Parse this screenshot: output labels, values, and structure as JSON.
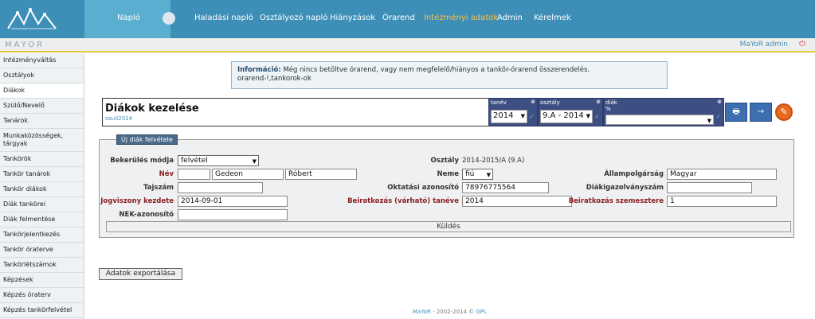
{
  "nav": {
    "active": "Napló",
    "items": [
      "Haladási napló",
      "Osztályozó napló",
      "Hiányzások",
      "Órarend",
      "Intézményi adatok",
      "Admin",
      "Kérelmek"
    ]
  },
  "brand": "MAYOR",
  "user": "MaYoR admin",
  "sidebar": [
    "Intézményváltás",
    "Osztályok",
    "Diákok",
    "Szülő/Nevelő",
    "Tanárok",
    "Munkaközösségek, tárgyak",
    "Tankörök",
    "Tankör tanárok",
    "Tankör diákok",
    "Diák tankörei",
    "Diák felmentése",
    "Tankörjelentkezés",
    "Tankör óraterve",
    "Tankörlétszámok",
    "Képzések",
    "Képzés óraterv",
    "Képzés tankörfelvétel"
  ],
  "info": {
    "label": "Információ:",
    "text": "Még nincs betöltve órarend, vagy nem megfelelő/hiányos a tankör-órarend összerendelés.",
    "line2": "orarend-!,tankorok-ok"
  },
  "header": {
    "title": "Diákok kezelése",
    "subtitle": "osuli2014",
    "tanev_label": "tanév",
    "tanev_value": "2014",
    "osztaly_label": "osztály",
    "osztaly_value": "9.A - 2014",
    "diak_label": "diák",
    "diak_sub": "%",
    "print_icon": "print-icon",
    "next_icon": "arrow-right-icon"
  },
  "form": {
    "legend": "Új diák felvétele",
    "bekerules_label": "Bekerülés módja",
    "bekerules_value": "felvétel",
    "nev_label": "Név",
    "nev_prefix": "",
    "nev_last": "Gedeon",
    "nev_first": "Róbert",
    "tajszam_label": "Tajszám",
    "tajszam_value": "",
    "jogviszony_label": "Jogviszony kezdete",
    "jogviszony_value": "2014-09-01",
    "nek_label": "NEK-azonosító",
    "nek_value": "",
    "osztaly_label": "Osztály",
    "osztaly_value": "2014-2015/A (9.A)",
    "neme_label": "Neme",
    "neme_value": "fiú",
    "oktatasi_label": "Oktatási azonosító",
    "oktatasi_value": "78976775564",
    "beiratkozas_tanev_label": "Beiratkozás (várható) tanéve",
    "beiratkozas_tanev_value": "2014",
    "allampolgarsag_label": "Állampolgárság",
    "allampolgarsag_value": "Magyar",
    "diakigazolvany_label": "Diákigazolványszám",
    "diakigazolvany_value": "",
    "beiratkozas_szem_label": "Beiratkozás szemesztere",
    "beiratkozas_szem_value": "1",
    "send_label": "Küldés"
  },
  "export_label": "Adatok exportálása",
  "footer": {
    "left": "MaYoR",
    "mid": " - 2002-2014 © ",
    "right": "GPL"
  }
}
